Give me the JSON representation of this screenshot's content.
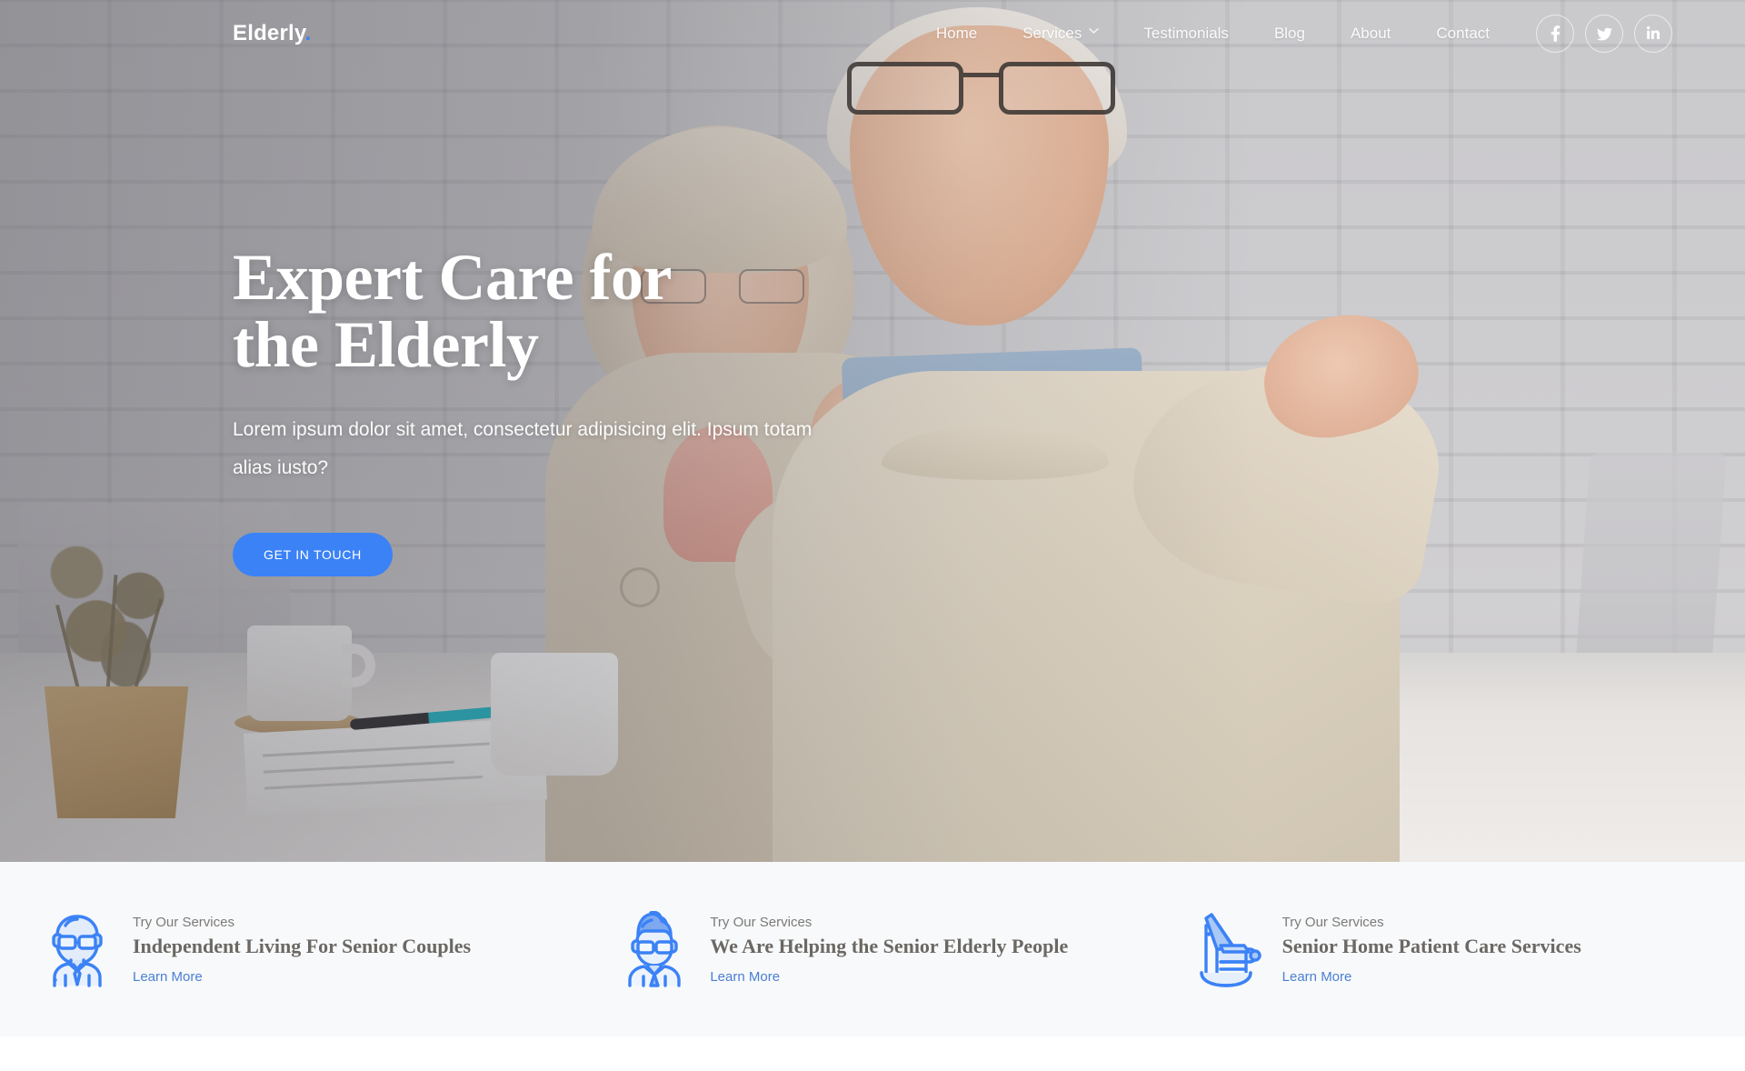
{
  "brand": {
    "name": "Elderly",
    "dot": ".",
    "accent": "#3b82f6"
  },
  "nav": {
    "items": [
      {
        "label": "Home",
        "has_dropdown": false
      },
      {
        "label": "Services",
        "has_dropdown": true
      },
      {
        "label": "Testimonials",
        "has_dropdown": false
      },
      {
        "label": "Blog",
        "has_dropdown": false
      },
      {
        "label": "About",
        "has_dropdown": false
      },
      {
        "label": "Contact",
        "has_dropdown": false
      }
    ],
    "social": [
      {
        "name": "facebook",
        "glyph": "f"
      },
      {
        "name": "twitter",
        "glyph": "t"
      },
      {
        "name": "linkedin",
        "glyph": "in"
      }
    ]
  },
  "hero": {
    "title": "Expert Care for the Elderly",
    "subtitle": "Lorem ipsum dolor sit amet, consectetur adipisicing elit. Ipsum totam alias iusto?",
    "cta_label": "GET IN TOUCH"
  },
  "services": {
    "background": "#f8f9fa",
    "link_color": "#4a7fd4",
    "cards": [
      {
        "icon": "elderly-man-icon",
        "kicker": "Try Our Services",
        "title": "Independent Living For Senior Couples",
        "link": "Learn More"
      },
      {
        "icon": "elderly-woman-icon",
        "kicker": "Try Our Services",
        "title": "We Are Helping the Senior Elderly People",
        "link": "Learn More"
      },
      {
        "icon": "rocking-chair-icon",
        "kicker": "Try Our Services",
        "title": "Senior Home Patient Care Services",
        "link": "Learn More"
      }
    ]
  }
}
